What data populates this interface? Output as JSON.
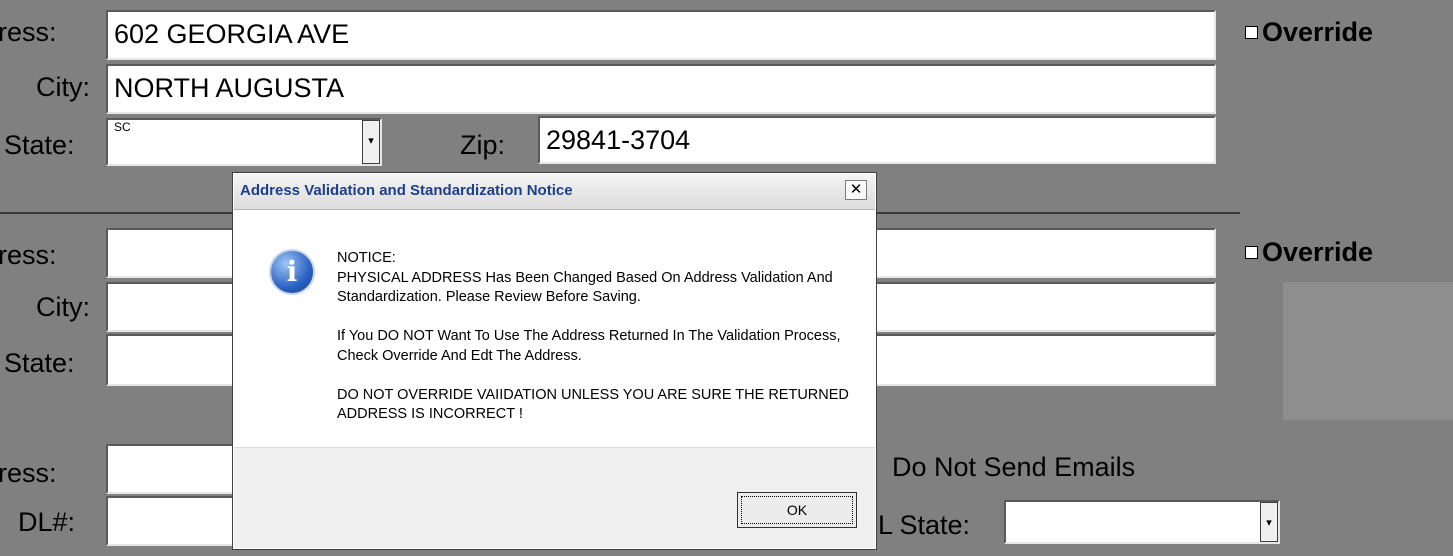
{
  "physical": {
    "address_label": "ress:",
    "address_value": "602 GEORGIA AVE",
    "city_label": "City:",
    "city_value": "NORTH AUGUSTA",
    "state_label": "State:",
    "state_value": "SC",
    "zip_label": "Zip:",
    "zip_value": "29841-3704",
    "override_label": "Override"
  },
  "mailing": {
    "address_label": "ress:",
    "address_value": "",
    "city_label": "City:",
    "city_value": "",
    "state_label": "State:",
    "state_value": "",
    "override_label": "Override"
  },
  "contact": {
    "email_label": "ress:",
    "email_value": "",
    "do_not_send_label": "Do Not Send Emails",
    "dl_label": "DL#:",
    "dl_value": "",
    "dl_state_label": "L State:",
    "dl_state_value": ""
  },
  "dialog": {
    "title": "Address Validation and Standardization Notice",
    "close_glyph": "✕",
    "icon": "info-icon",
    "heading": "NOTICE:",
    "line1": "PHYSICAL ADDRESS Has Been Changed Based On Address Validation And Standardization. Please Review Before Saving.",
    "line2": "If You DO NOT Want To Use The Address Returned In The Validation Process, Check Override And Edt The Address.",
    "line3": "DO NOT OVERRIDE VAIIDATION UNLESS YOU ARE SURE THE RETURNED ADDRESS IS INCORRECT !",
    "ok_label": "OK"
  },
  "dropdown_glyph": "▾"
}
